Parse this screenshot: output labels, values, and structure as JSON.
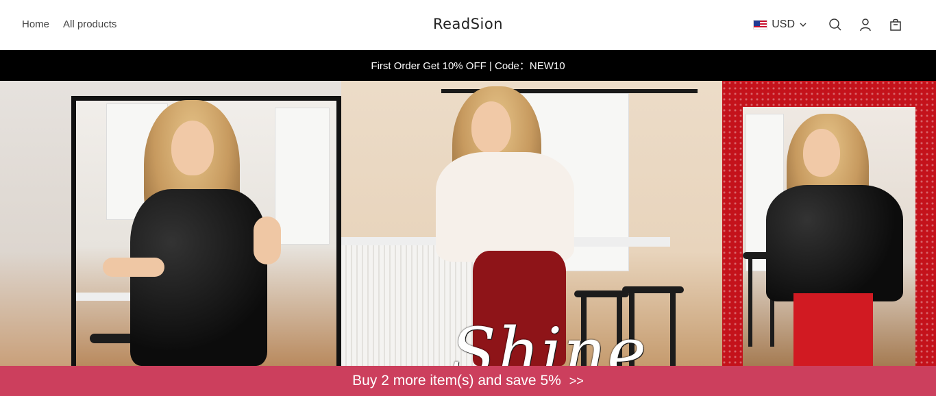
{
  "header": {
    "nav": [
      {
        "label": "Home"
      },
      {
        "label": "All products"
      }
    ],
    "logo": "ReadSion",
    "currency": {
      "label": "USD",
      "flag": "us-flag-icon"
    },
    "icons": [
      "search-icon",
      "account-icon",
      "cart-icon"
    ]
  },
  "announcement": {
    "text": "First Order Get 10% OFF | Code：NEW10"
  },
  "hero": {
    "script_text": "Shine"
  },
  "promo": {
    "text": "Buy 2 more item(s) and save 5%",
    "arrow": ">>",
    "color": "#cc3f5d"
  }
}
